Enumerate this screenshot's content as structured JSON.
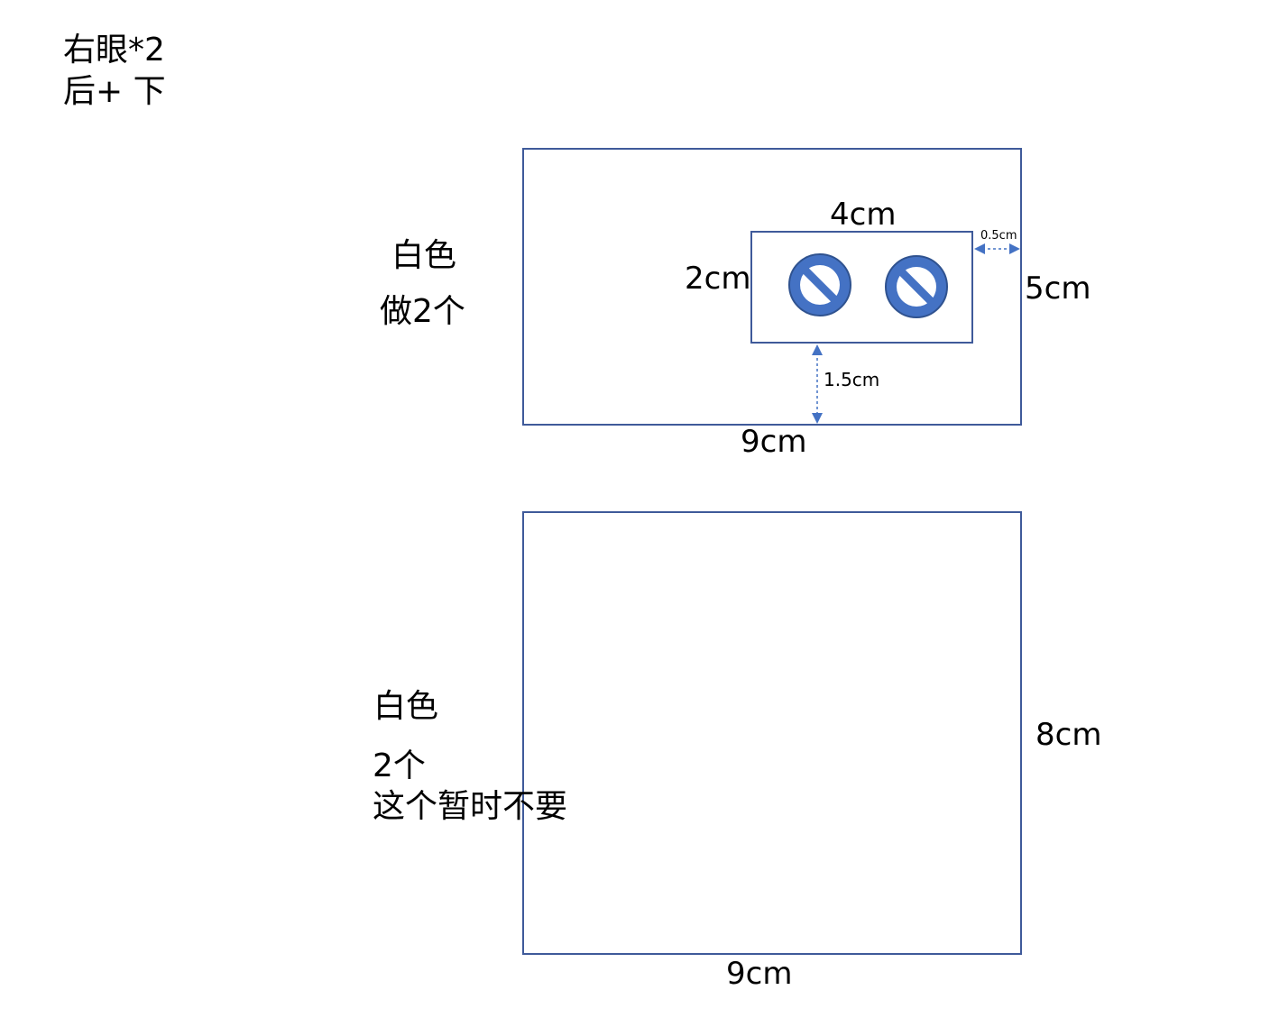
{
  "header": {
    "line1": "右眼*2",
    "line2": "后+ 下"
  },
  "panel_top": {
    "color_label": "白色",
    "count_label": "做2个",
    "width_label": "9cm",
    "height_label": "5cm",
    "inner": {
      "width_label": "4cm",
      "height_label": "2cm",
      "right_gap_label": "0.5cm",
      "bottom_gap_label": "1.5cm",
      "icon_count": 2
    }
  },
  "panel_bottom": {
    "color_label": "白色",
    "count_label": "2个",
    "note_label": "这个暂时不要",
    "width_label": "9cm",
    "height_label": "8cm"
  },
  "colors": {
    "border": "#3f5a9a",
    "icon_fill": "#4472c4",
    "icon_stroke": "#2f528f",
    "arrow": "#4472c4"
  },
  "icons": [
    "no-entry-icon",
    "no-entry-icon"
  ]
}
